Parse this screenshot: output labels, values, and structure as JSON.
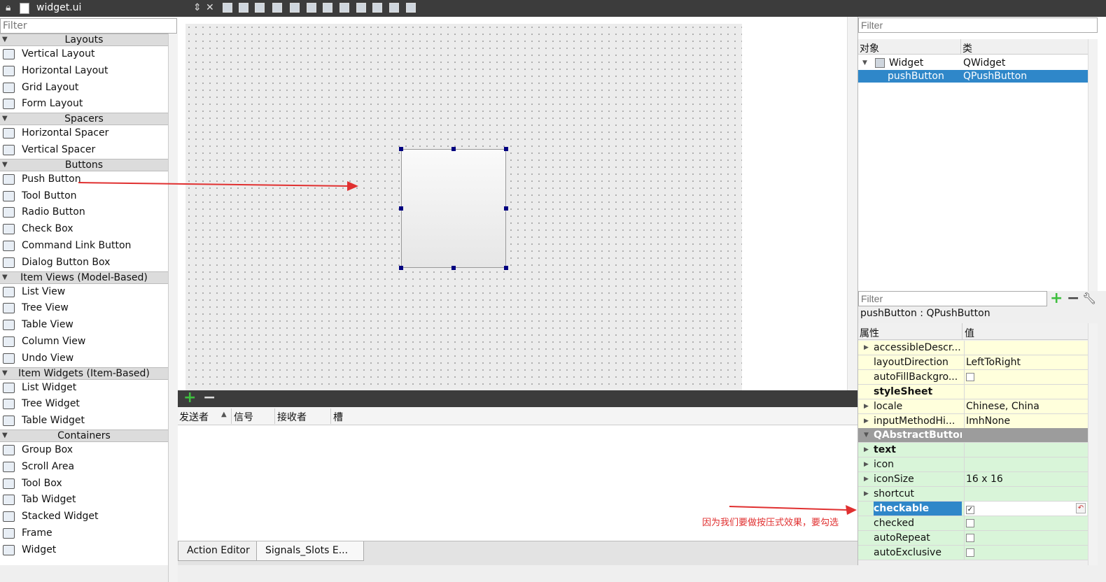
{
  "window": {
    "file_title": "widget.ui"
  },
  "widget_box": {
    "filter_placeholder": "Filter",
    "categories": [
      {
        "name": "Layouts",
        "items": [
          "Vertical Layout",
          "Horizontal Layout",
          "Grid Layout",
          "Form Layout"
        ]
      },
      {
        "name": "Spacers",
        "items": [
          "Horizontal Spacer",
          "Vertical Spacer"
        ]
      },
      {
        "name": "Buttons",
        "items": [
          "Push Button",
          "Tool Button",
          "Radio Button",
          "Check Box",
          "Command Link Button",
          "Dialog Button Box"
        ]
      },
      {
        "name": "Item Views (Model-Based)",
        "items": [
          "List View",
          "Tree View",
          "Table View",
          "Column View",
          "Undo View"
        ]
      },
      {
        "name": "Item Widgets (Item-Based)",
        "items": [
          "List Widget",
          "Tree Widget",
          "Table Widget"
        ]
      },
      {
        "name": "Containers",
        "items": [
          "Group Box",
          "Scroll Area",
          "Tool Box",
          "Tab Widget",
          "Stacked Widget",
          "Frame",
          "Widget"
        ]
      }
    ]
  },
  "signal_slot_editor": {
    "headers": [
      "发送者",
      "信号",
      "接收者",
      "槽"
    ],
    "tabs": [
      "Action Editor",
      "Signals_Slots E..."
    ]
  },
  "object_inspector": {
    "filter_placeholder": "Filter",
    "headers": [
      "对象",
      "类"
    ],
    "rows": [
      {
        "object": "Widget",
        "class": "QWidget"
      },
      {
        "object": "pushButton",
        "class": "QPushButton"
      }
    ]
  },
  "property_editor": {
    "filter_placeholder": "Filter",
    "object_label": "pushButton : QPushButton",
    "headers": [
      "属性",
      "值"
    ],
    "rows": [
      {
        "name": "accessibleDescr...",
        "value": "",
        "style": "y",
        "expand": true
      },
      {
        "name": "layoutDirection",
        "value": "LeftToRight",
        "style": "y"
      },
      {
        "name": "autoFillBackgro...",
        "value": "",
        "style": "y",
        "checkbox": true,
        "checked": false
      },
      {
        "name": "styleSheet",
        "value": "",
        "style": "y",
        "bold": true
      },
      {
        "name": "locale",
        "value": "Chinese, China",
        "style": "y",
        "expand": true
      },
      {
        "name": "inputMethodHi...",
        "value": "ImhNone",
        "style": "y",
        "expand": true
      },
      {
        "name": "QAbstractButton",
        "value": "",
        "style": "cat",
        "expand": true
      },
      {
        "name": "text",
        "value": "",
        "style": "g",
        "bold": true,
        "expand": true
      },
      {
        "name": "icon",
        "value": "",
        "style": "g",
        "expand": true
      },
      {
        "name": "iconSize",
        "value": "16 x 16",
        "style": "g",
        "expand": true
      },
      {
        "name": "shortcut",
        "value": "",
        "style": "g",
        "expand": true
      },
      {
        "name": "checkable",
        "value": "",
        "style": "g",
        "bold": true,
        "checkbox": true,
        "checked": true,
        "selected": true
      },
      {
        "name": "checked",
        "value": "",
        "style": "g",
        "checkbox": true,
        "checked": false
      },
      {
        "name": "autoRepeat",
        "value": "",
        "style": "g",
        "checkbox": true,
        "checked": false
      },
      {
        "name": "autoExclusive",
        "value": "",
        "style": "g",
        "checkbox": true,
        "checked": false
      }
    ]
  },
  "annotation": {
    "text": "因为我们要做按压式效果，要勾选"
  },
  "colors": {
    "selection": "#2f87c9",
    "annotation": "#e03030",
    "handle": "#000080"
  }
}
